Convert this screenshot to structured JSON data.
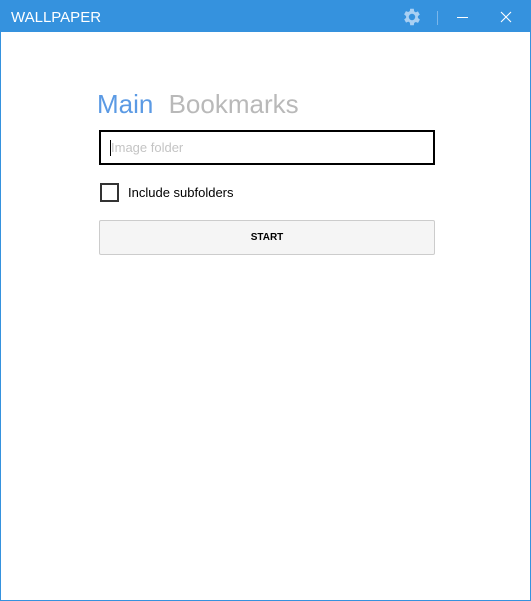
{
  "window": {
    "title": "WALLPAPER",
    "accent_color": "#3592de"
  },
  "titlebar": {
    "icons": [
      "gear-icon",
      "minimize-icon",
      "close-icon"
    ]
  },
  "tabs": [
    {
      "label": "Main",
      "active": true
    },
    {
      "label": "Bookmarks",
      "active": false
    }
  ],
  "folder_input": {
    "value": "",
    "placeholder": "Image folder"
  },
  "subfolders": {
    "label": "Include subfolders",
    "checked": false
  },
  "start_button": {
    "label": "START"
  }
}
